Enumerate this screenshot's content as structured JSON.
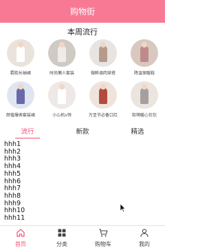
{
  "navbar": {
    "title": "购物街"
  },
  "recommend": {
    "title": "本周流行",
    "items": [
      {
        "label": "羁街长袖裙",
        "bg": "#e9e3dc",
        "fg": "#ffffff"
      },
      {
        "label": "时尚懒人套装",
        "bg": "#cfcac4",
        "fg": "#f0ebe6"
      },
      {
        "label": "微醉调肉穿搭",
        "bg": "#e7e4e1",
        "fg": "#b89a8a"
      },
      {
        "label": "降温保暖鞋",
        "bg": "#d8c9c0",
        "fg": "#c08a8a"
      },
      {
        "label": "颜值爆表套装裙",
        "bg": "#dfe6f2",
        "fg": "#6a6aa8"
      },
      {
        "label": "小心机v领",
        "bg": "#eee8e6",
        "fg": "#ffffff"
      },
      {
        "label": "万圣节必备口红",
        "bg": "#efe3dd",
        "fg": "#b44a3e"
      },
      {
        "label": "软萌暖心包包",
        "bg": "#ece4df",
        "fg": "#a4a0a0"
      }
    ]
  },
  "tabs": [
    {
      "label": "流行",
      "active": true
    },
    {
      "label": "新款",
      "active": false
    },
    {
      "label": "精选",
      "active": false
    }
  ],
  "list": [
    "hhh1",
    "hhh2",
    "hhh3",
    "hhh4",
    "hhh5",
    "hhh6",
    "hhh7",
    "hhh8",
    "hhh9",
    "hhh10",
    "hhh11"
  ],
  "tabbar": [
    {
      "label": "首页",
      "icon": "home-icon",
      "active": true
    },
    {
      "label": "分类",
      "icon": "category-icon",
      "active": false
    },
    {
      "label": "购物车",
      "icon": "cart-icon",
      "active": false
    },
    {
      "label": "我的",
      "icon": "profile-icon",
      "active": false
    }
  ],
  "colors": {
    "accent": "#f14f73",
    "navbar": "#f77994"
  }
}
